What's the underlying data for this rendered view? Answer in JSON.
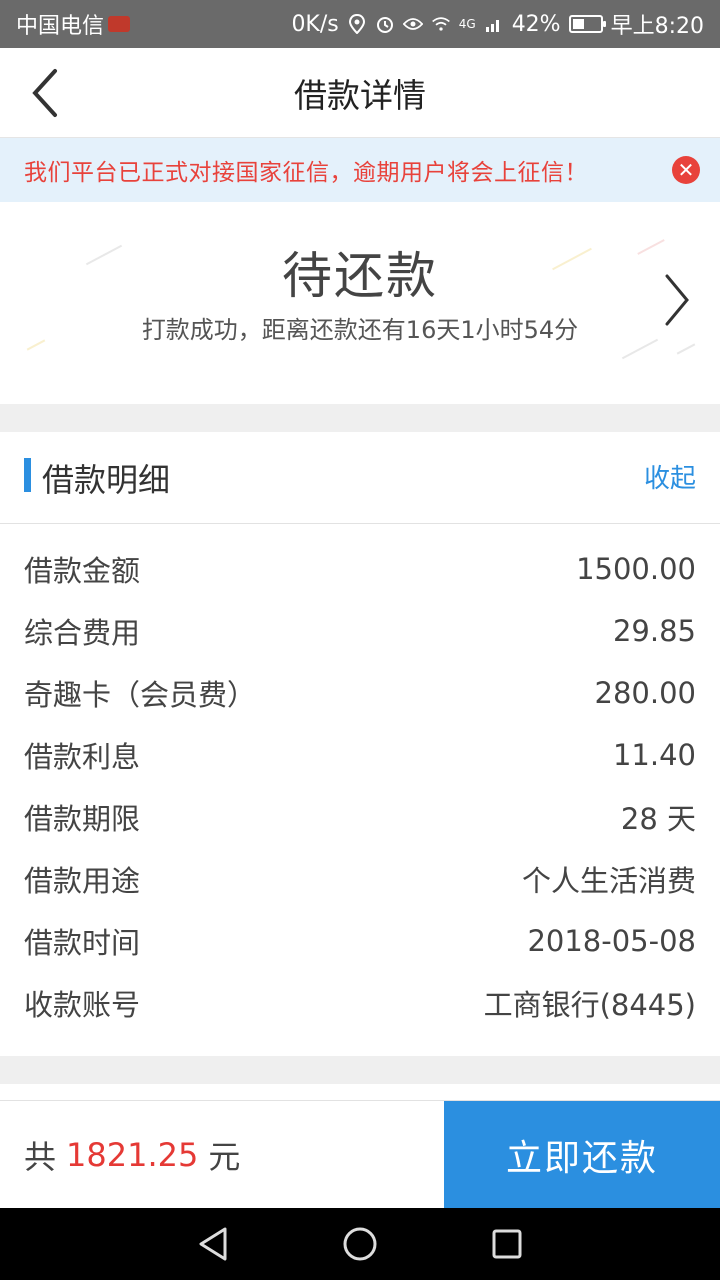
{
  "statusbar": {
    "carrier": "中国电信",
    "speed": "0K/s",
    "network": "4G",
    "battery": "42%",
    "battery_level": 0.42,
    "time": "早上8:20"
  },
  "navbar": {
    "title": "借款详情"
  },
  "notice": {
    "text": "我们平台已正式对接国家征信，逾期用户将会上征信！",
    "color": "#e8423b"
  },
  "status": {
    "title": "待还款",
    "subtitle": "打款成功，距离还款还有16天1小时54分"
  },
  "detail": {
    "section_title": "借款明细",
    "collapse_label": "收起",
    "rows": [
      {
        "label": "借款金额",
        "value": "1500.00"
      },
      {
        "label": "综合费用",
        "value": "29.85"
      },
      {
        "label": "奇趣卡（会员费）",
        "value": "280.00"
      },
      {
        "label": "借款利息",
        "value": "11.40"
      },
      {
        "label": "借款期限",
        "value": "28 天"
      },
      {
        "label": "借款用途",
        "value": "个人生活消费"
      },
      {
        "label": "借款时间",
        "value": "2018-05-08"
      },
      {
        "label": "收款账号",
        "value": "工商银行(8445)"
      }
    ]
  },
  "footer": {
    "prefix": "共",
    "amount": "1821.25",
    "unit": "元",
    "pay_label": "立即还款",
    "accent": "#2b8fe0",
    "amount_color": "#e53935"
  },
  "icons": {
    "back": "chevron-left-icon",
    "close": "close-circle-icon",
    "status_arrow": "chevron-right-icon",
    "nav_back": "triangle-back-icon",
    "nav_home": "circle-home-icon",
    "nav_recent": "square-recent-icon"
  }
}
